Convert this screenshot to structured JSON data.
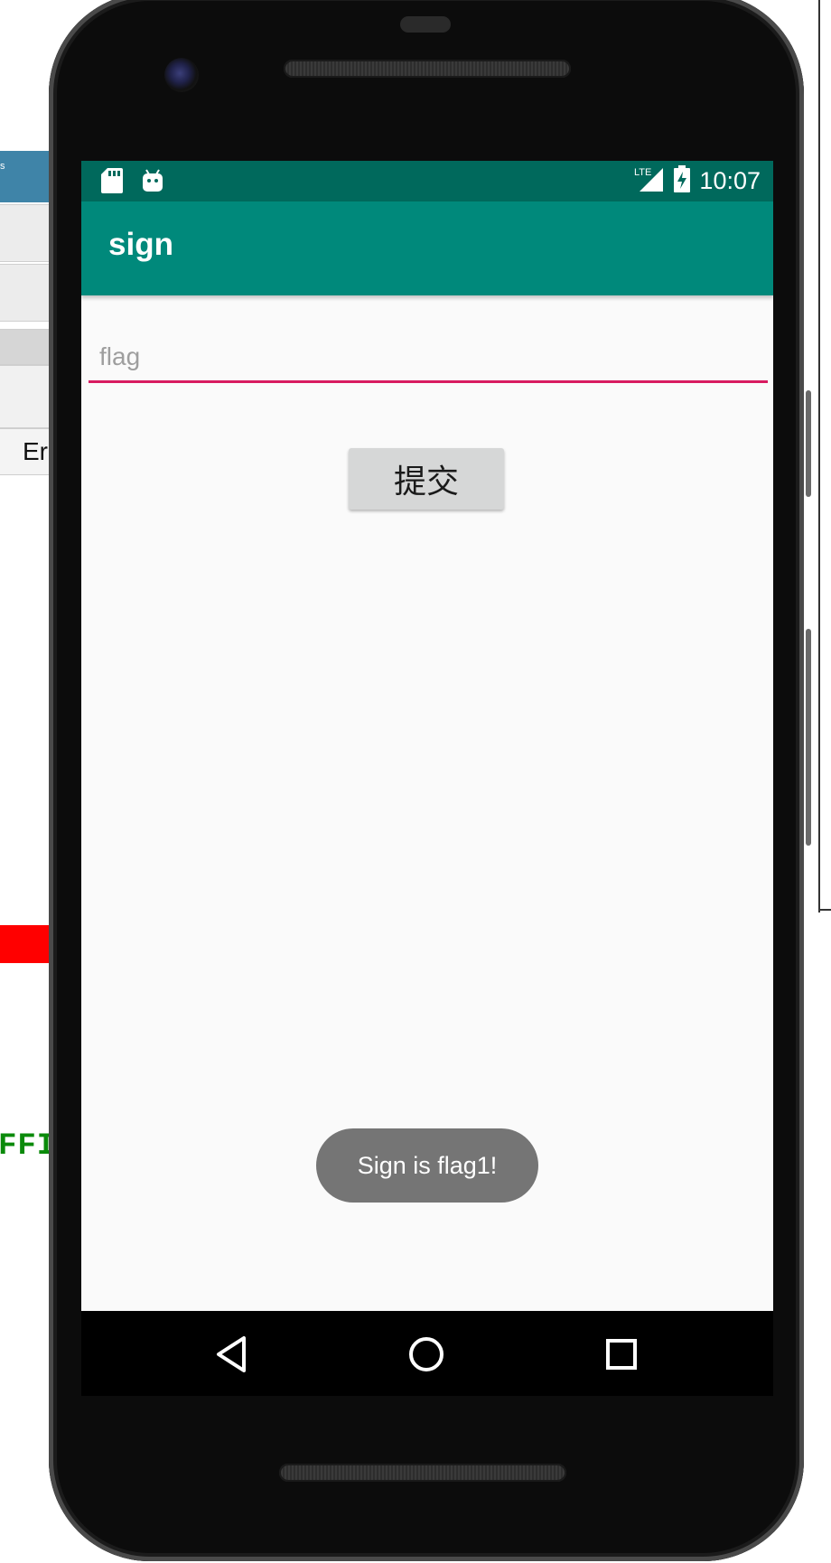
{
  "background_window": {
    "tab_text": "Er",
    "green_text": "FFI",
    "title_glyph": "s"
  },
  "status_bar": {
    "time": "10:07",
    "network": "LTE",
    "icons": [
      "sd-card-icon",
      "android-icon",
      "signal-icon",
      "battery-charging-icon"
    ]
  },
  "app_bar": {
    "title": "sign"
  },
  "form": {
    "flag_placeholder": "flag",
    "flag_value": "",
    "submit_label": "提交"
  },
  "toast": {
    "message": "Sign is flag1!"
  },
  "nav_bar": {
    "icons": [
      "back-icon",
      "home-icon",
      "recents-icon"
    ]
  },
  "colors": {
    "status_bar": "#00695c",
    "app_bar": "#00897b",
    "input_underline": "#d81b60",
    "toast_bg": "#757575",
    "button_bg": "#d6d7d7"
  }
}
